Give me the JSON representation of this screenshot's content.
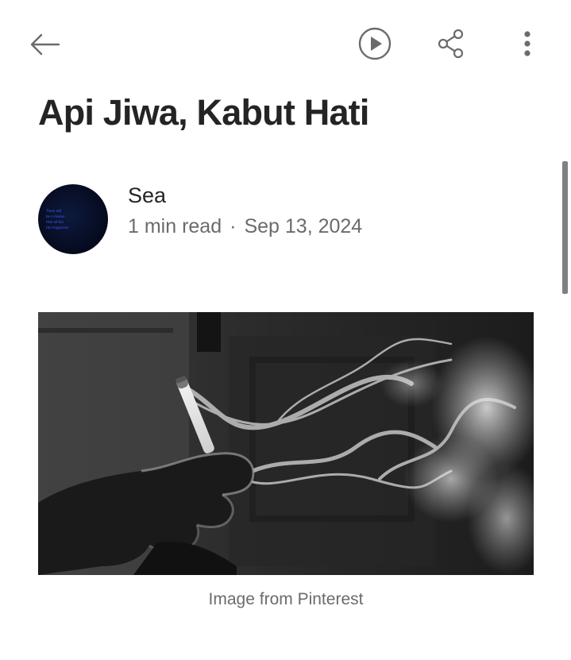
{
  "toolbar": {
    "back_icon": "arrow-left-icon",
    "listen_icon": "play-circle-icon",
    "share_icon": "share-icon",
    "more_icon": "more-vertical-icon"
  },
  "article": {
    "title": "Api Jiwa, Kabut Hati",
    "author": {
      "name": "Sea",
      "avatar_text": "There will\nbe a reason\nthat all the\nthe happiness"
    },
    "read_time": "1 min read",
    "separator": "·",
    "date": "Sep 13, 2024",
    "hero_image": {
      "caption": "Image from Pinterest",
      "subject": "hand holding a cigarette with smoke"
    }
  },
  "colors": {
    "text": "#242424",
    "muted": "#6b6b6b",
    "icon": "#6b6b6b",
    "scrollbar": "#808080"
  }
}
